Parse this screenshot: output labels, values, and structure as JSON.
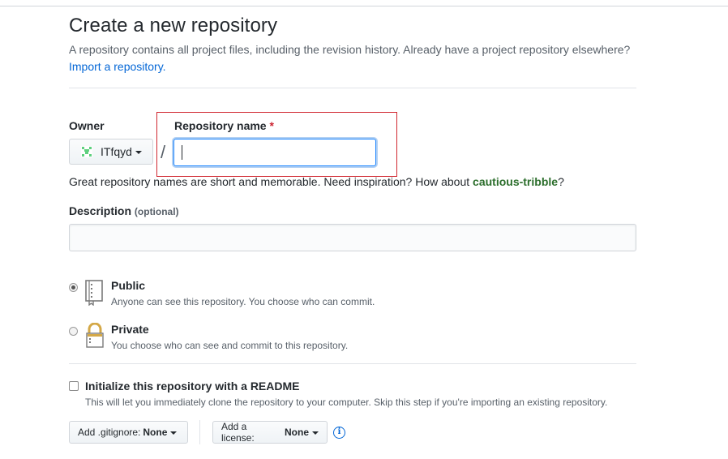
{
  "page": {
    "title": "Create a new repository",
    "subtitle": "A repository contains all project files, including the revision history. Already have a project repository elsewhere?",
    "import_link": "Import a repository."
  },
  "owner": {
    "label": "Owner",
    "value": "ITfqyd"
  },
  "repo_name": {
    "label": "Repository name",
    "required_mark": "*",
    "value": "",
    "separator": "/"
  },
  "hint": {
    "text": "Great repository names are short and memorable. Need inspiration? How about ",
    "suggestion": "cautious-tribble",
    "end": "?"
  },
  "description": {
    "label": "Description",
    "optional": "(optional)",
    "value": ""
  },
  "visibility": {
    "public": {
      "title": "Public",
      "desc": "Anyone can see this repository. You choose who can commit.",
      "icon": "repo-icon",
      "selected": true
    },
    "private": {
      "title": "Private",
      "desc": "You choose who can see and commit to this repository.",
      "icon": "lock-icon",
      "selected": false
    }
  },
  "readme": {
    "title": "Initialize this repository with a README",
    "desc": "This will let you immediately clone the repository to your computer. Skip this step if you're importing an existing repository.",
    "checked": false
  },
  "gitignore": {
    "label": "Add .gitignore:",
    "value": "None"
  },
  "license": {
    "label": "Add a license:",
    "value": "None"
  },
  "colors": {
    "link": "#0366d6",
    "required": "#cb2431",
    "suggestion": "#2c6e2c",
    "highlight_box": "#d0262f"
  }
}
